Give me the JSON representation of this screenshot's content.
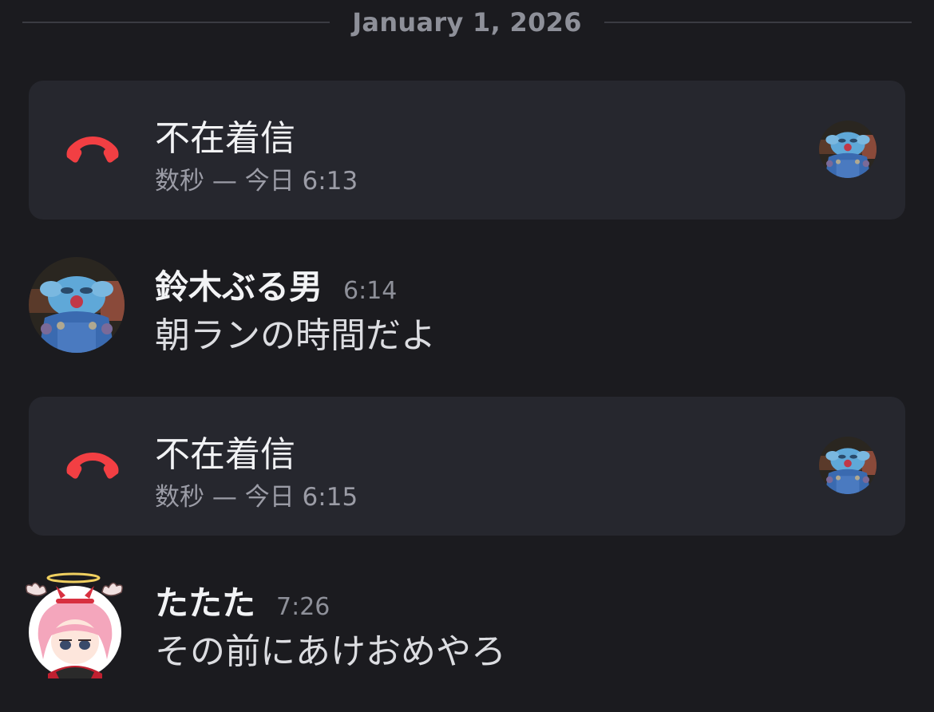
{
  "date_divider": "January 1, 2026",
  "colors": {
    "background": "#1b1b1f",
    "card": "#26272e",
    "missed_call_red": "#f23f43",
    "muted_text": "#8e9099"
  },
  "calls": [
    {
      "icon": "phone-hangup-icon",
      "title": "不在着信",
      "meta": "数秒 — 今日 6:13",
      "participant_avatar": "blue-mascot-avatar"
    },
    {
      "icon": "phone-hangup-icon",
      "title": "不在着信",
      "meta": "数秒 — 今日 6:15",
      "participant_avatar": "blue-mascot-avatar"
    }
  ],
  "messages": [
    {
      "avatar": "blue-mascot-avatar",
      "username": "鈴木ぶる男",
      "time": "6:14",
      "text": "朝ランの時間だよ"
    },
    {
      "avatar": "anime-girl-avatar",
      "username": "たたた",
      "time": "7:26",
      "text": "その前にあけおめやろ"
    }
  ]
}
